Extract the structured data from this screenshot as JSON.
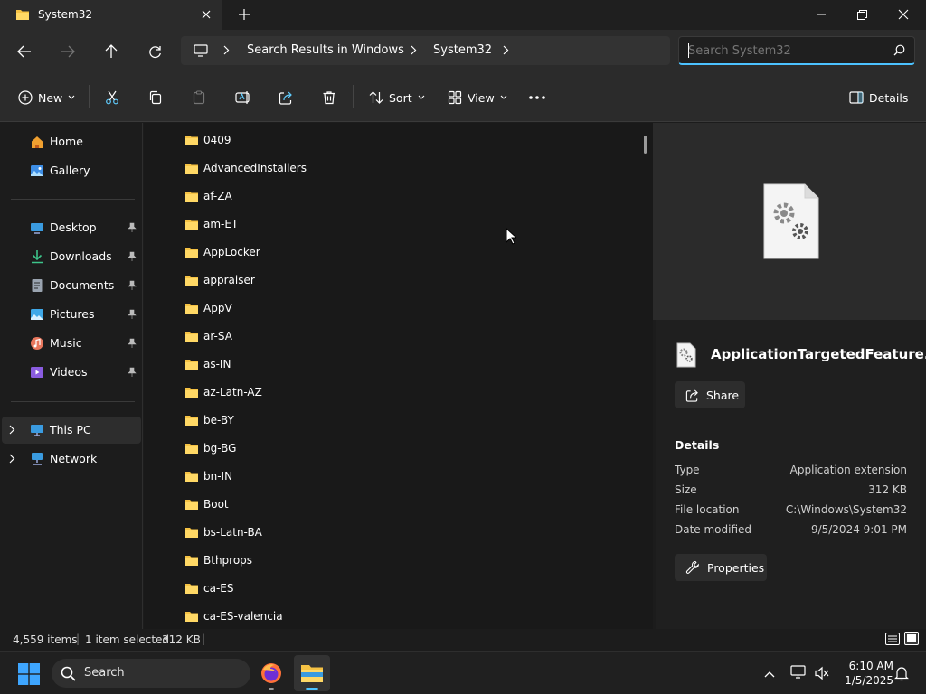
{
  "window": {
    "tab_title": "System32",
    "new_tab_symbol": "+"
  },
  "address": {
    "breadcrumb": [
      "Search Results in Windows",
      "System32"
    ],
    "search_placeholder": "Search System32"
  },
  "toolbar": {
    "new_label": "New",
    "sort_label": "Sort",
    "view_label": "View",
    "details_label": "Details",
    "icons": [
      "cut-icon",
      "copy-icon",
      "paste-icon",
      "rename-icon",
      "share-icon",
      "delete-icon",
      "more-icon"
    ]
  },
  "sidebar": {
    "top": [
      {
        "label": "Home",
        "icon": "home-icon"
      },
      {
        "label": "Gallery",
        "icon": "gallery-icon"
      }
    ],
    "pinned": [
      {
        "label": "Desktop",
        "icon": "desktop-icon"
      },
      {
        "label": "Downloads",
        "icon": "downloads-icon"
      },
      {
        "label": "Documents",
        "icon": "documents-icon"
      },
      {
        "label": "Pictures",
        "icon": "pictures-icon"
      },
      {
        "label": "Music",
        "icon": "music-icon"
      },
      {
        "label": "Videos",
        "icon": "videos-icon"
      }
    ],
    "drives": [
      {
        "label": "This PC",
        "icon": "pc-icon",
        "selected": true
      },
      {
        "label": "Network",
        "icon": "network-icon",
        "selected": false
      }
    ]
  },
  "files": [
    "0409",
    "AdvancedInstallers",
    "af-ZA",
    "am-ET",
    "AppLocker",
    "appraiser",
    "AppV",
    "ar-SA",
    "as-IN",
    "az-Latn-AZ",
    "be-BY",
    "bg-BG",
    "bn-IN",
    "Boot",
    "bs-Latn-BA",
    "Bthprops",
    "ca-ES",
    "ca-ES-valencia"
  ],
  "details": {
    "file_name": "ApplicationTargetedFeature...",
    "share_label": "Share",
    "heading": "Details",
    "rows": [
      {
        "key": "Type",
        "value": "Application extension"
      },
      {
        "key": "Size",
        "value": "312 KB"
      },
      {
        "key": "File location",
        "value": "C:\\Windows\\System32"
      },
      {
        "key": "Date modified",
        "value": "9/5/2024 9:01 PM"
      }
    ],
    "properties_label": "Properties"
  },
  "status": {
    "items_count": "4,559 items",
    "selected": "1 item selected",
    "selected_size": "312 KB"
  },
  "taskbar": {
    "search_label": "Search",
    "time": "6:10 AM",
    "date": "1/5/2025"
  },
  "colors": {
    "accent": "#4cc2ff",
    "folder": "#f5c244",
    "background": "#191919"
  }
}
